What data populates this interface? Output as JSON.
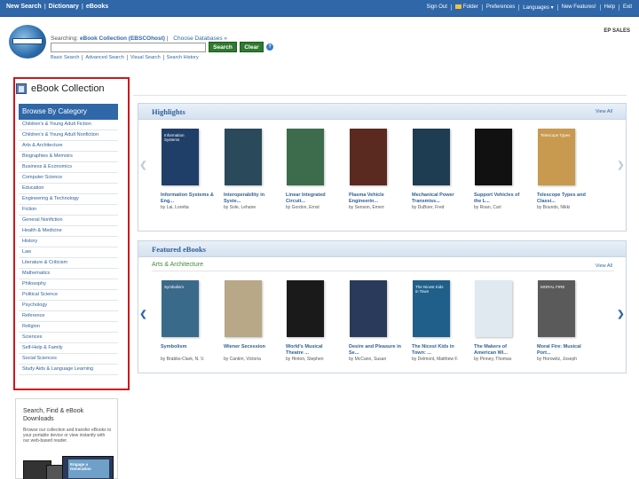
{
  "topbar": {
    "nav": [
      "New Search",
      "Dictionary",
      "eBooks"
    ],
    "right_links": [
      "Sign Out",
      "Folder",
      "Preferences",
      "Languages ▾",
      "New Features!",
      "Help",
      "Exit"
    ]
  },
  "search": {
    "searching_label": "Searching:",
    "database": "eBook Collection (EBSCOhost)",
    "choose_databases": "Choose Databases »",
    "query": "",
    "search_button": "Search",
    "clear_button": "Clear",
    "links": [
      "Basic Search",
      "Advanced Search",
      "Visual Search",
      "Search History"
    ]
  },
  "institution": "EP SALES",
  "page_title": "eBook Collection",
  "sidebar": {
    "header": "Browse By Category",
    "categories": [
      "Children's & Young Adult Fiction",
      "Children's & Young Adult Nonfiction",
      "Arts & Architecture",
      "Biographies & Memoirs",
      "Business & Economics",
      "Computer Science",
      "Education",
      "Engineering & Technology",
      "Fiction",
      "General Nonfiction",
      "Health & Medicine",
      "History",
      "Law",
      "Literature & Criticism",
      "Mathematics",
      "Philosophy",
      "Political Science",
      "Psychology",
      "Reference",
      "Religion",
      "Sciences",
      "Self-Help & Family",
      "Social Sciences",
      "Study Aids & Language Learning"
    ]
  },
  "promo": {
    "title": "Search, Find & eBook Downloads",
    "text": "Browse our collection and transfer eBooks to your portable device or view instantly with our web-based reader.",
    "screen_text": "Engage a Generation"
  },
  "highlights": {
    "title": "Highlights",
    "view_all": "View All",
    "books": [
      {
        "title": "Information Systems & Eng...",
        "author": "by Lai, Loretta",
        "cover_color": "#1f3f68",
        "cover_text": "Information Systems"
      },
      {
        "title": "Interoperability in Syste...",
        "author": "by Sole, Lehane",
        "cover_color": "#2a4a5c",
        "cover_text": ""
      },
      {
        "title": "Linear Integrated Circuit...",
        "author": "by Gordon, Ernst",
        "cover_color": "#3c6c4c",
        "cover_text": ""
      },
      {
        "title": "Plasma Vehicle Engineerin...",
        "author": "by Senson, Emerr",
        "cover_color": "#5a2a20",
        "cover_text": ""
      },
      {
        "title": "Mechanical Power Transmiss...",
        "author": "by DuBoer, Fred",
        "cover_color": "#1e3c52",
        "cover_text": ""
      },
      {
        "title": "Support Vehicles of the L...",
        "author": "by Roan, Carl",
        "cover_color": "#111111",
        "cover_text": ""
      },
      {
        "title": "Telescope Types and Classi...",
        "author": "by Bounds, Nikki",
        "cover_color": "#c89a50",
        "cover_text": "Telescope Types"
      }
    ]
  },
  "featured": {
    "title": "Featured eBooks",
    "category": "Arts & Architecture",
    "view_all": "View All",
    "books": [
      {
        "title": "Symbolism",
        "author": "by Brabbs-Clark, N. V.",
        "cover_color": "#3a6a8a",
        "cover_text": "Symbolism"
      },
      {
        "title": "Wiener Secession",
        "author": "by Cantim, Victoria",
        "cover_color": "#b8a888",
        "cover_text": ""
      },
      {
        "title": "World's Musical Theatre ...",
        "author": "by Hinton, Stephen",
        "cover_color": "#1a1a1a",
        "cover_text": ""
      },
      {
        "title": "Desire and Pleasure in Se...",
        "author": "by McCann, Susan",
        "cover_color": "#2a3a5a",
        "cover_text": ""
      },
      {
        "title": "The Nicest Kids in Town: ...",
        "author": "by Delmont, Matthew F.",
        "cover_color": "#1f5f8a",
        "cover_text": "The Nicest Kids in Town"
      },
      {
        "title": "The Makers of American Wi...",
        "author": "by Pinney, Thomas",
        "cover_color": "#dfe9ef",
        "cover_text": ""
      },
      {
        "title": "Moral Fire: Musical Port...",
        "author": "by Horowitz, Joseph",
        "cover_color": "#5a5a5a",
        "cover_text": "MORAL FIRE"
      }
    ]
  },
  "colors": {
    "brand_blue": "#2f67a8",
    "button_green": "#2f7a2f",
    "annotation_red": "#d0161a"
  }
}
